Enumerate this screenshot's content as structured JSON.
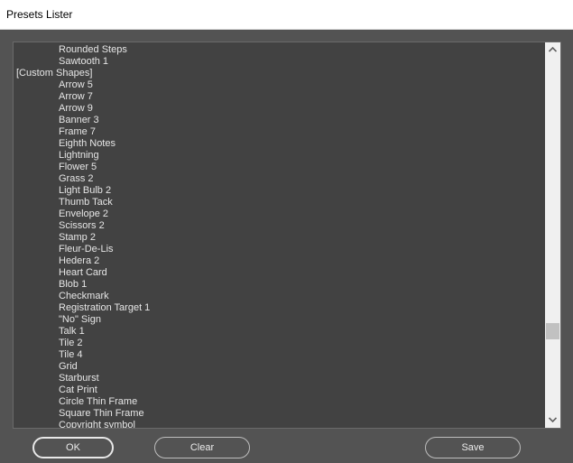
{
  "window": {
    "title": "Presets Lister"
  },
  "list": {
    "rows": [
      {
        "text": "Rounded Steps",
        "kind": "item"
      },
      {
        "text": "Sawtooth 1",
        "kind": "item"
      },
      {
        "text": "[Custom Shapes]",
        "kind": "category"
      },
      {
        "text": "Arrow 5",
        "kind": "item"
      },
      {
        "text": "Arrow 7",
        "kind": "item"
      },
      {
        "text": "Arrow 9",
        "kind": "item"
      },
      {
        "text": "Banner 3",
        "kind": "item"
      },
      {
        "text": "Frame 7",
        "kind": "item"
      },
      {
        "text": "Eighth Notes",
        "kind": "item"
      },
      {
        "text": "Lightning",
        "kind": "item"
      },
      {
        "text": "Flower 5",
        "kind": "item"
      },
      {
        "text": "Grass 2",
        "kind": "item"
      },
      {
        "text": "Light Bulb 2",
        "kind": "item"
      },
      {
        "text": "Thumb Tack",
        "kind": "item"
      },
      {
        "text": "Envelope 2",
        "kind": "item"
      },
      {
        "text": "Scissors 2",
        "kind": "item"
      },
      {
        "text": "Stamp 2",
        "kind": "item"
      },
      {
        "text": "Fleur-De-Lis",
        "kind": "item"
      },
      {
        "text": "Hedera 2",
        "kind": "item"
      },
      {
        "text": "Heart Card",
        "kind": "item"
      },
      {
        "text": "Blob 1",
        "kind": "item"
      },
      {
        "text": "Checkmark",
        "kind": "item"
      },
      {
        "text": "Registration Target 1",
        "kind": "item"
      },
      {
        "text": "\"No\" Sign",
        "kind": "item"
      },
      {
        "text": "Talk 1",
        "kind": "item"
      },
      {
        "text": "Tile 2",
        "kind": "item"
      },
      {
        "text": "Tile 4",
        "kind": "item"
      },
      {
        "text": "Grid",
        "kind": "item"
      },
      {
        "text": "Starburst",
        "kind": "item"
      },
      {
        "text": "Cat Print",
        "kind": "item"
      },
      {
        "text": "Circle Thin Frame",
        "kind": "item"
      },
      {
        "text": "Square Thin Frame",
        "kind": "item"
      },
      {
        "text": "Copyright symbol",
        "kind": "item"
      }
    ]
  },
  "scrollbar": {
    "up_icon": "chevron-up-icon",
    "down_icon": "chevron-down-icon"
  },
  "buttons": {
    "ok_label": "OK",
    "clear_label": "Clear",
    "save_label": "Save"
  }
}
